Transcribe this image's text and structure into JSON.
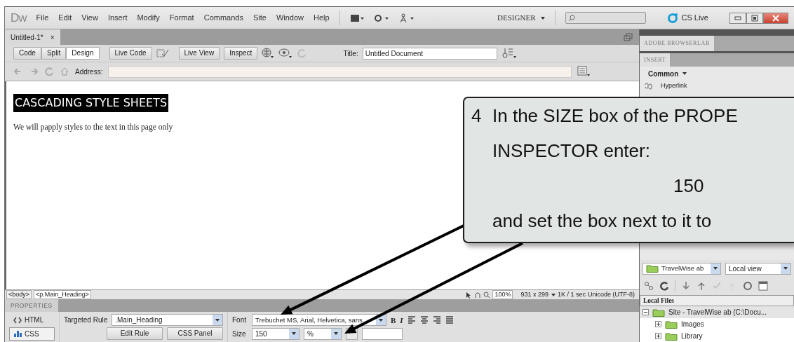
{
  "app_logo": "Dw",
  "menu": [
    "File",
    "Edit",
    "View",
    "Insert",
    "Modify",
    "Format",
    "Commands",
    "Site",
    "Window",
    "Help"
  ],
  "workspace": "DESIGNER",
  "cs_live": "CS Live",
  "document_tab": {
    "title": "Untitled-1*",
    "close": "×"
  },
  "view_buttons": [
    {
      "label": "Code",
      "selected": false
    },
    {
      "label": "Split",
      "selected": false
    },
    {
      "label": "Design",
      "selected": true
    }
  ],
  "live_code": "Live Code",
  "live_view": "Live View",
  "inspect": "Inspect",
  "title_label": "Title:",
  "title_value": "Untitled Document",
  "address_label": "Address:",
  "page": {
    "heading": "CASCADING STYLE SHEETS",
    "paragraph": "We will papply styles to the text in this page only"
  },
  "tag_selector": [
    {
      "label": "<body>",
      "selected": false
    },
    {
      "label": "<p.Main_Heading>",
      "selected": true
    }
  ],
  "status": {
    "zoom": "100%",
    "dimensions": "931 x 299",
    "info": "1K / 1 sec",
    "encoding": "Unicode (UTF-8)"
  },
  "properties": {
    "title": "PROPERTIES",
    "modes": [
      {
        "label": "HTML",
        "selected": false
      },
      {
        "label": "CSS",
        "selected": true
      }
    ],
    "targeted_rule_label": "Targeted Rule",
    "targeted_rule": ".Main_Heading",
    "edit_rule": "Edit Rule",
    "css_panel": "CSS Panel",
    "font_label": "Font",
    "font": "Trebuchet MS, Arial, Helvetica, sans",
    "bold": "B",
    "italic": "I",
    "size_label": "Size",
    "size": "150",
    "unit": "%"
  },
  "panels": {
    "tabs": [
      "ADOBE BROWSERLAB",
      "INSERT"
    ],
    "insert_category": "Common",
    "insert_items": [
      "Hyperlink"
    ],
    "site": "TravelWise ab",
    "view": "Local view",
    "files_header": "Local Files",
    "tree": [
      {
        "label": "Site - TravelWise ab (C:\\Docu...",
        "expanded": true,
        "selected": true,
        "children": [
          {
            "label": "Images",
            "expanded": false,
            "selected": false
          },
          {
            "label": "Library",
            "expanded": false,
            "selected": false
          }
        ]
      }
    ]
  },
  "callout": {
    "step": "4",
    "lines": [
      "In the SIZE box of the PROPE",
      "INSPECTOR enter:",
      "150",
      "and set the box next to it to"
    ]
  }
}
